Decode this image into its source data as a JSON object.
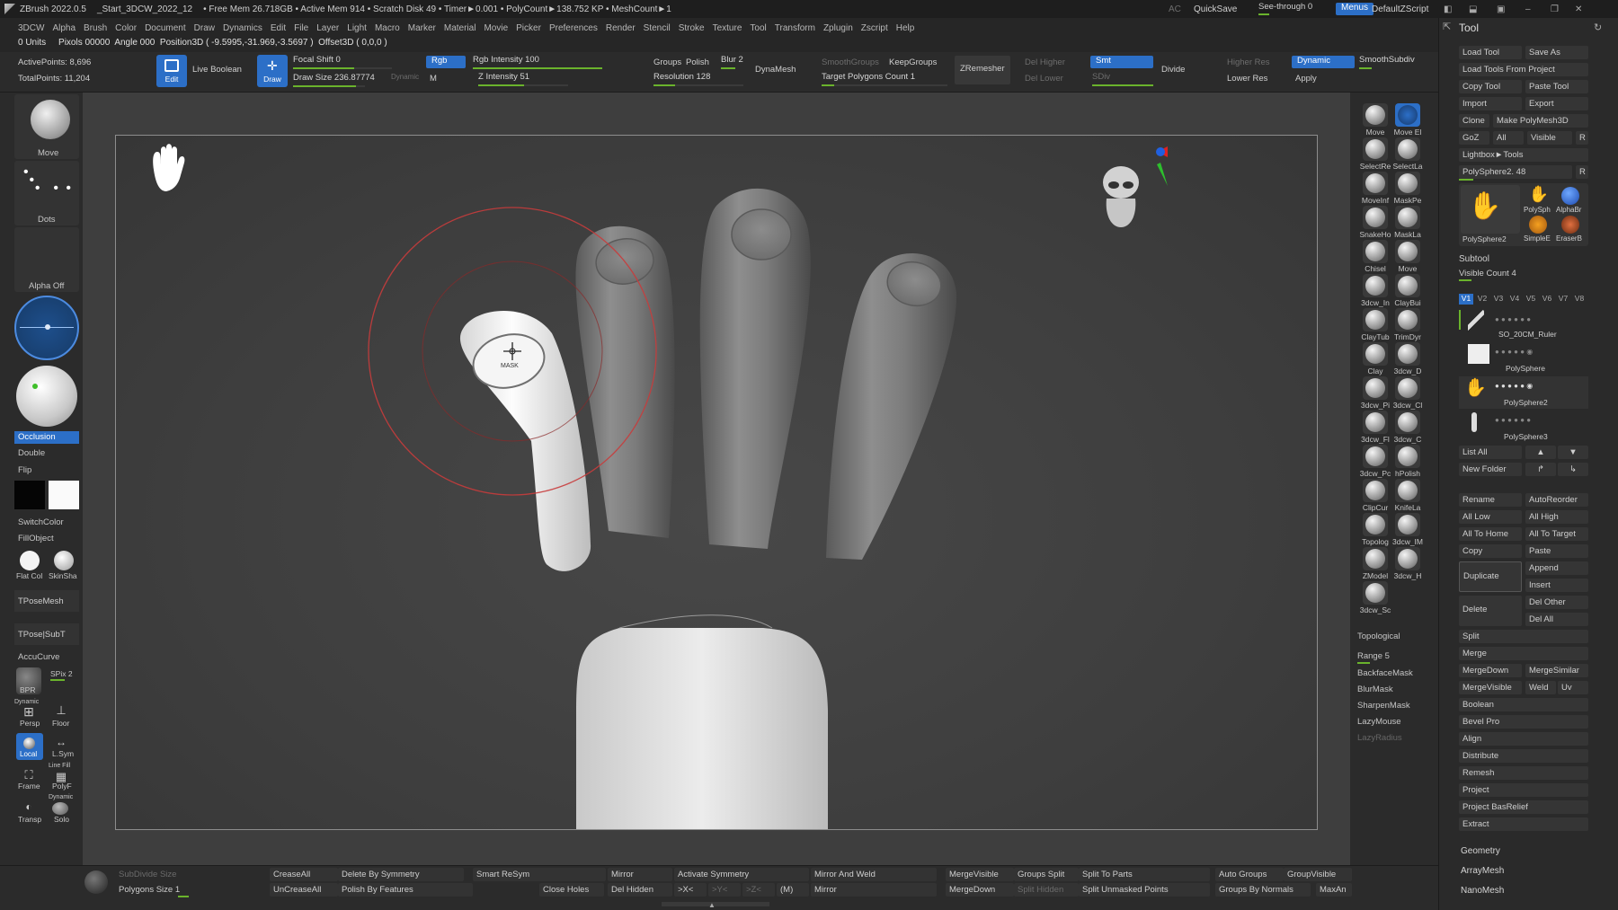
{
  "titlebar": {
    "app": "ZBrush 2022.0.5",
    "file": "_Start_3DCW_2022_12",
    "stats": "• Free Mem 26.718GB • Active Mem 914 • Scratch Disk 49 • Timer►0.001 • PolyCount►138.752 KP • MeshCount►1",
    "ac": "AC",
    "quicksave": "QuickSave",
    "seethrough": "See-through 0",
    "menus": "Menus",
    "zscript": "DefaultZScript"
  },
  "menubar": [
    "3DCW",
    "Alpha",
    "Brush",
    "Color",
    "Document",
    "Draw",
    "Dynamics",
    "Edit",
    "File",
    "Layer",
    "Light",
    "Macro",
    "Marker",
    "Material",
    "Movie",
    "Picker",
    "Preferences",
    "Render",
    "Stencil",
    "Stroke",
    "Texture",
    "Tool",
    "Transform",
    "Zplugin",
    "Zscript",
    "Help"
  ],
  "infobar": {
    "units": "0 Units",
    "pixols": "Pixols 00000",
    "angle": "Angle 000",
    "position": "Position3D ( -9.5995,-31.969,-3.5697 )",
    "offset": "Offset3D ( 0,0,0 )"
  },
  "toolbar": {
    "active_points": "ActivePoints: 8,696",
    "total_points": "TotalPoints: 11,204",
    "edit": "Edit",
    "live_boolean": "Live Boolean",
    "draw": "Draw",
    "focal_shift": "Focal Shift 0",
    "draw_size": "Draw Size 236.87774",
    "dynamic_small": "Dynamic",
    "rgb": "Rgb",
    "m": "M",
    "rgb_intensity": "Rgb Intensity 100",
    "z_intensity": "Z Intensity 51",
    "groups": "Groups",
    "polish": "Polish",
    "blur": "Blur 2",
    "resolution": "Resolution 128",
    "dynamesh": "DynaMesh",
    "smooth_groups": "SmoothGroups",
    "keep_groups": "KeepGroups",
    "target_polygons": "Target Polygons Count 1",
    "zremesher": "ZRemesher",
    "del_higher": "Del Higher",
    "del_lower": "Del Lower",
    "smt": "Smt",
    "sdiv": "SDiv",
    "divide": "Divide",
    "higher_res": "Higher Res",
    "lower_res": "Lower Res",
    "dynamic": "Dynamic",
    "apply": "Apply",
    "smooth_subdiv": "SmoothSubdiv"
  },
  "left_shelf": {
    "move": "Move",
    "dots": "Dots",
    "alpha_off": "Alpha Off",
    "occlusion": "Occlusion",
    "double": "Double",
    "flip": "Flip",
    "switch_color": "SwitchColor",
    "fill_object": "FillObject",
    "flat_col": "Flat Col",
    "skin_sha": "SkinSha",
    "tpose_mesh": "TPoseMesh",
    "tpose_subt": "TPose|SubT",
    "accucurve": "AccuCurve",
    "bpr": "BPR",
    "spix": "SPix 2",
    "dynamic": "Dynamic",
    "persp": "Persp",
    "floor": "Floor",
    "local": "Local",
    "lsym": "L.Sym",
    "line_fill": "Line Fill",
    "frame": "Frame",
    "polyf": "PolyF",
    "transp": "Transp",
    "dynamic2": "Dynamic",
    "solo": "Solo"
  },
  "viewport": {
    "cursor_label": "MASK"
  },
  "right_shelf": {
    "brushes": [
      "Move",
      "Move El",
      "SelectRe",
      "SelectLa",
      "MoveInf",
      "MaskPe",
      "SnakeHo",
      "MaskLa",
      "Chisel",
      "Move",
      "3dcw_In",
      "ClayBui",
      "ClayTub",
      "TrimDyr",
      "Clay",
      "3dcw_D",
      "3dcw_Pi",
      "3dcw_Cl",
      "3dcw_Fl",
      "3dcw_C",
      "3dcw_Pc",
      "hPolish",
      "ClipCur",
      "KnifeLa",
      "Topolog",
      "3dcw_IM",
      "ZModel",
      "3dcw_H",
      "3dcw_Sc"
    ],
    "topological": "Topological",
    "range": "Range 5",
    "backface": "BackfaceMask",
    "blurmask": "BlurMask",
    "sharpenmask": "SharpenMask",
    "lazymouse": "LazyMouse",
    "lazyradius": "LazyRadius"
  },
  "tool_panel": {
    "title": "Tool",
    "load_tool": "Load Tool",
    "save_as": "Save As",
    "load_from_project": "Load Tools From Project",
    "copy_tool": "Copy Tool",
    "paste_tool": "Paste Tool",
    "import": "Import",
    "export": "Export",
    "clone": "Clone",
    "make_polymesh": "Make PolyMesh3D",
    "goz": "GoZ",
    "all": "All",
    "visible": "Visible",
    "r": "R",
    "lightbox_tools": "Lightbox►Tools",
    "polysphere_slider": "PolySphere2. 48",
    "thumbs": [
      "PolySphere2",
      "PolySph",
      "AlphaBr",
      "SimpleE",
      "EraserB"
    ],
    "subtool_title": "Subtool",
    "visible_count": "Visible Count 4",
    "versions": [
      "V1",
      "V2",
      "V3",
      "V4",
      "V5",
      "V6",
      "V7",
      "V8"
    ],
    "subtools": [
      "SO_20CM_Ruler",
      "PolySphere",
      "PolySphere2",
      "PolySphere3"
    ],
    "list_all": "List All",
    "new_folder": "New Folder",
    "rename": "Rename",
    "autoreorder": "AutoReorder",
    "all_low": "All Low",
    "all_high": "All High",
    "all_to_home": "All To Home",
    "all_to_target": "All To Target",
    "copy": "Copy",
    "paste": "Paste",
    "duplicate": "Duplicate",
    "append": "Append",
    "insert": "Insert",
    "delete": "Delete",
    "del_other": "Del Other",
    "del_all": "Del All",
    "split": "Split",
    "merge": "Merge",
    "merge_down": "MergeDown",
    "merge_similar": "MergeSimilar",
    "merge_visible": "MergeVisible",
    "weld": "Weld",
    "uv": "Uv",
    "boolean": "Boolean",
    "bevel_pro": "Bevel Pro",
    "align": "Align",
    "distribute": "Distribute",
    "remesh": "Remesh",
    "project": "Project",
    "project_basrelief": "Project BasRelief",
    "extract": "Extract",
    "geometry": "Geometry",
    "arraymesh": "ArrayMesh",
    "nanomesh": "NanoMesh"
  },
  "bottom_bar": {
    "subdivide_size": "SubDivide Size",
    "polygons_size": "Polygons Size 1",
    "crease_all": "CreaseAll",
    "uncrease_all": "UnCreaseAll",
    "delete_by_symmetry": "Delete By Symmetry",
    "polish_by_features": "Polish By Features",
    "smart_resym": "Smart ReSym",
    "close_holes": "Close Holes",
    "mirror": "Mirror",
    "del_hidden": "Del Hidden",
    "activate_symmetry": "Activate Symmetry",
    "x": ">X<",
    "y": ">Y<",
    "z": ">Z<",
    "m": "(M)",
    "mirror_and_weld": "Mirror And Weld",
    "mirror2": "Mirror",
    "merge_visible": "MergeVisible",
    "merge_down": "MergeDown",
    "groups_split": "Groups Split",
    "split_hidden": "Split Hidden",
    "split_to_parts": "Split To Parts",
    "split_unmasked": "Split Unmasked Points",
    "auto_groups": "Auto Groups",
    "groups_by_normals": "Groups By Normals",
    "group_visible": "GroupVisible",
    "max_angle": "MaxAn"
  },
  "colors": {
    "accent_blue": "#2c6fc7",
    "slider_green": "#6ab32c",
    "brush_ring": "#c83c3c"
  }
}
